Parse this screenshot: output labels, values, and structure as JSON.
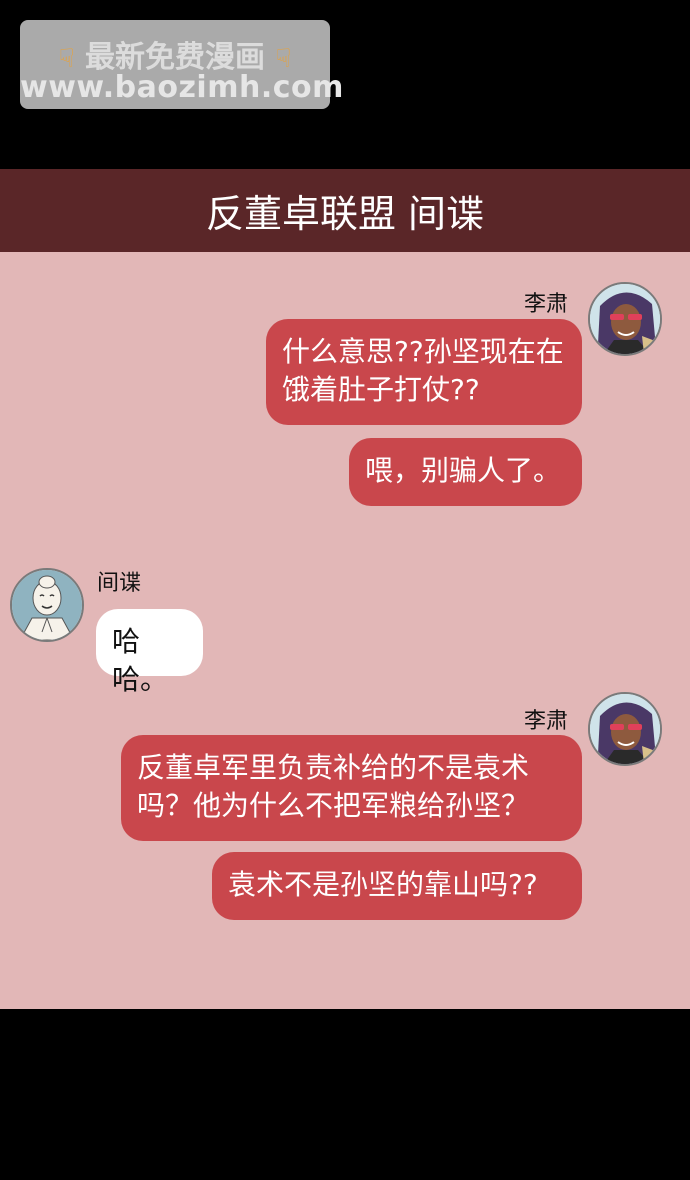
{
  "watermark": {
    "line1": "最新免费漫画",
    "line2": "www.baozimh.com"
  },
  "header": {
    "title": "反董卓联盟 间谍"
  },
  "colors": {
    "header_bg": "#5a2628",
    "chat_bg": "#e2b7b7",
    "bubble_right": "#c9474c",
    "bubble_left": "#ffffff"
  },
  "messages": [
    {
      "sender": "李肃",
      "texts": [
        "什么意思??孙坚现在在饿着肚子打仗??",
        "喂，别骗人了。"
      ]
    },
    {
      "sender": "间谍",
      "texts": [
        "哈哈。"
      ]
    },
    {
      "sender": "李肃",
      "texts": [
        "反董卓军里负责补给的不是袁术吗？他为什么不把军粮给孙坚？",
        "袁术不是孙坚的靠山吗??"
      ]
    }
  ]
}
